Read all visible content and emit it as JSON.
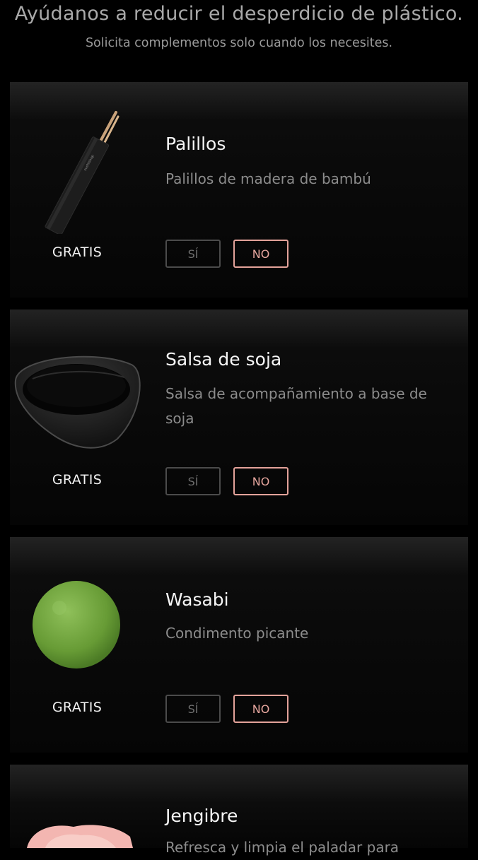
{
  "header": {
    "title": "Ayúdanos a reducir el desperdicio de plástico.",
    "subtitle": "Solicita complementos solo cuando los necesites."
  },
  "items": [
    {
      "name": "Palillos",
      "description": "Palillos de madera de bambú",
      "price": "GRATIS",
      "yes_label": "SÍ",
      "no_label": "NO",
      "selected": "NO",
      "icon": "chopsticks-icon",
      "brand_mark": "sushishop"
    },
    {
      "name": "Salsa de soja",
      "description": "Salsa de acompañamiento a base de soja",
      "price": "GRATIS",
      "yes_label": "SÍ",
      "no_label": "NO",
      "selected": "NO",
      "icon": "soy-sauce-dish-icon"
    },
    {
      "name": "Wasabi",
      "description": "Condimento picante",
      "price": "GRATIS",
      "yes_label": "SÍ",
      "no_label": "NO",
      "selected": "NO",
      "icon": "wasabi-ball-icon"
    },
    {
      "name": "Jengibre",
      "description": "Refresca y limpia el paladar para",
      "icon": "pickled-ginger-icon"
    }
  ],
  "colors": {
    "background": "#000000",
    "accent": "#e3a29a",
    "muted": "#8c8c8c"
  }
}
